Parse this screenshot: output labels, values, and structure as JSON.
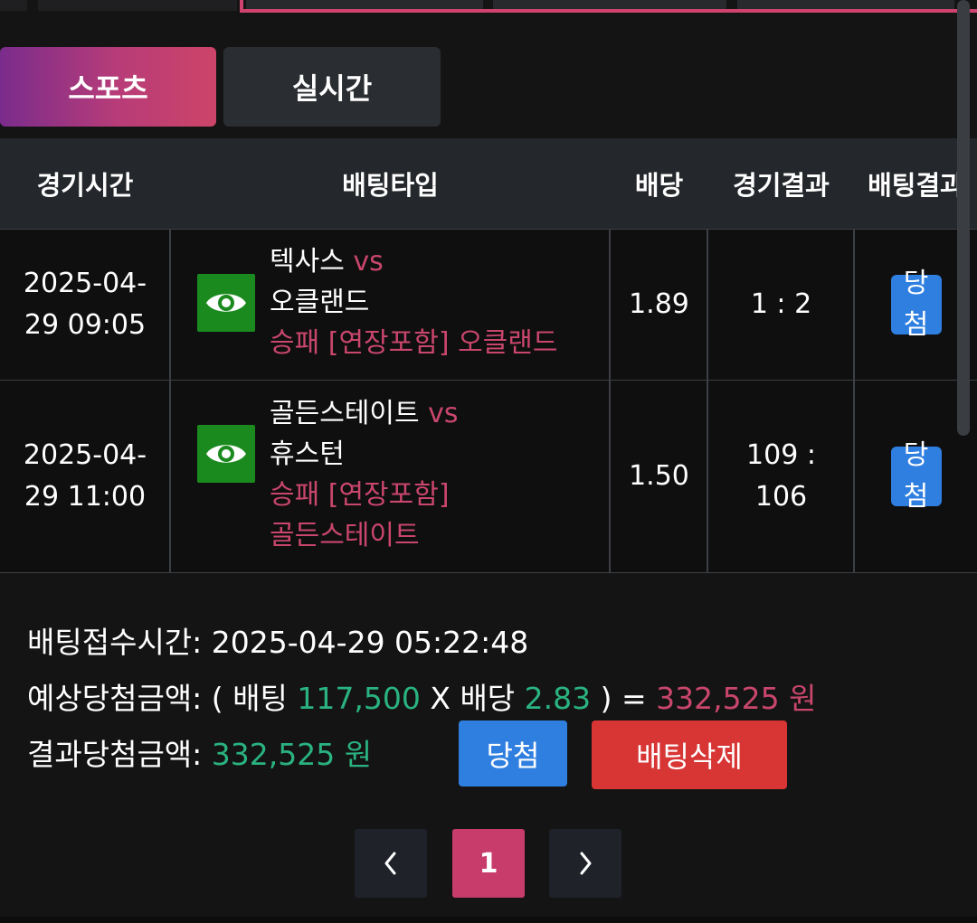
{
  "tabs": [
    {
      "label": "스포츠",
      "active": true
    },
    {
      "label": "실시간",
      "active": false
    }
  ],
  "table": {
    "headers": [
      "경기시간",
      "배팅타입",
      "배당",
      "경기결과",
      "배팅결과"
    ],
    "rows": [
      {
        "time_line1": "2025-04-",
        "time_line2": "29 09:05",
        "home": "텍사스",
        "vs": "vs",
        "away": "오클랜드",
        "pick": "승패 [연장포함] 오클랜드",
        "odds": "1.89",
        "score": "1 : 2",
        "result": "당첨"
      },
      {
        "time_line1": "2025-04-",
        "time_line2": "29 11:00",
        "home": "골든스테이트",
        "vs": "vs",
        "away": "휴스턴",
        "pick_line1": "승패 [연장포함]",
        "pick_line2": "골든스테이트",
        "odds": "1.50",
        "score_line1": "109 :",
        "score_line2": "106",
        "result": "당첨"
      }
    ]
  },
  "summary": {
    "received_label": "배팅접수시간:",
    "received_value": "2025-04-29 05:22:48",
    "expected_label": "예상당첨금액:",
    "expected_open": "( 배팅",
    "bet_amount": "117,500",
    "times": "X 배당",
    "total_odds": "2.83",
    "expected_close": ") =",
    "expected_amount": "332,525 원",
    "result_label": "결과당첨금액:",
    "result_amount": "332,525 원"
  },
  "buttons": {
    "win": "당첨",
    "delete": "배팅삭제"
  },
  "pagination": {
    "prev": "‹",
    "current": "1",
    "next": "›"
  },
  "icons": {
    "row_icon": "eye-icon"
  },
  "colors": {
    "accent_pink": "#c9466c",
    "green": "#2ab381",
    "blue": "#2f7fe0",
    "red": "#d83535",
    "eye_bg": "#1a8a1e"
  }
}
